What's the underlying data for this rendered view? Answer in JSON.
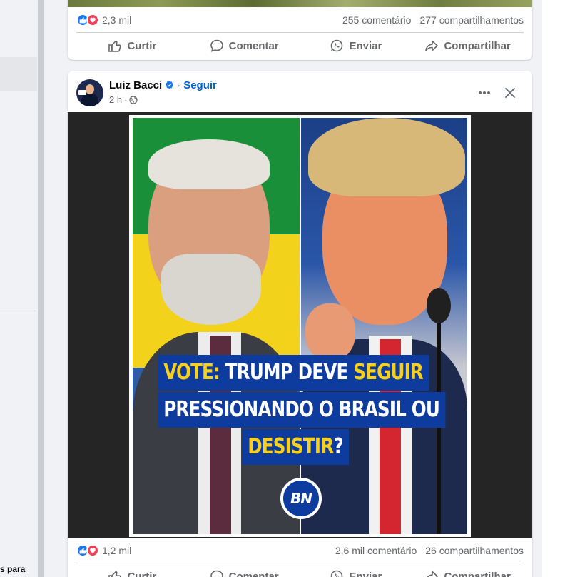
{
  "left_sidebar": {
    "bottom_text": "s para"
  },
  "prev_post": {
    "stats": {
      "reaction_count": "2,3 mil",
      "comments": "255 comentário",
      "shares": "277 compartilhamentos"
    },
    "actions": {
      "like": "Curtir",
      "comment": "Comentar",
      "send": "Enviar",
      "share": "Compartilhar"
    }
  },
  "post": {
    "author": "Luiz Bacci",
    "follow_label": "Seguir",
    "separator": "·",
    "time": "2 h",
    "time_sep": "·",
    "image": {
      "headline_line1_accent": "VOTE:",
      "headline_line1_rest": " TRUMP DEVE ",
      "headline_line1_accent2": "SEGUIR",
      "headline_line2": "PRESSIONANDO O BRASIL OU",
      "headline_line3_accent": "DESISTIR",
      "headline_line3_rest": "?",
      "logo_text": "BN"
    },
    "stats": {
      "reaction_count": "1,2 mil",
      "comments": "2,6 mil comentário",
      "shares": "26 compartilhamentos"
    },
    "actions": {
      "like": "Curtir",
      "comment": "Comentar",
      "send": "Enviar",
      "share": "Compartilhar"
    }
  },
  "icons": {
    "like": "thumbs-up-icon",
    "love": "heart-icon",
    "comment": "speech-bubble-icon",
    "send": "whatsapp-icon",
    "share": "share-arrow-icon",
    "verified": "verified-badge-icon",
    "privacy": "globe-icon",
    "more": "more-dots-icon",
    "close": "close-icon"
  },
  "colors": {
    "facebook_blue": "#1877f2",
    "link_blue": "#0064d1",
    "love_red": "#f33e58",
    "poster_blue": "#0d3c9e",
    "poster_yellow": "#f8d01a"
  }
}
